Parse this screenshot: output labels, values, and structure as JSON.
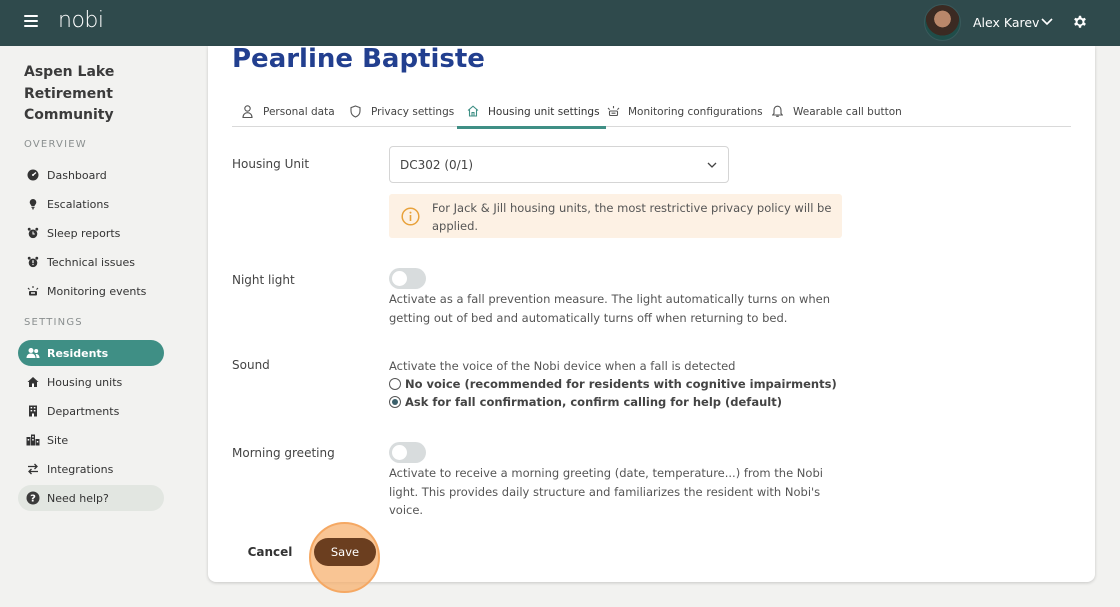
{
  "header": {
    "app_name": "nobi",
    "user_name": "Alex Karev"
  },
  "sidebar": {
    "org_name": "Aspen Lake Retirement Community",
    "overview_heading": "OVERVIEW",
    "settings_heading": "SETTINGS",
    "overview_items": [
      {
        "label": "Dashboard",
        "icon": "dashboard-icon"
      },
      {
        "label": "Escalations",
        "icon": "escalation-icon"
      },
      {
        "label": "Sleep reports",
        "icon": "alarm-clock-icon"
      },
      {
        "label": "Technical issues",
        "icon": "warning-clock-icon"
      },
      {
        "label": "Monitoring events",
        "icon": "monitoring-icon"
      }
    ],
    "settings_items": [
      {
        "label": "Residents",
        "icon": "users-icon",
        "active": true
      },
      {
        "label": "Housing units",
        "icon": "house-icon"
      },
      {
        "label": "Departments",
        "icon": "building-icon"
      },
      {
        "label": "Site",
        "icon": "city-icon"
      },
      {
        "label": "Integrations",
        "icon": "arrows-icon"
      }
    ],
    "help_label": "Need help?"
  },
  "main": {
    "title": "Pearline Baptiste",
    "tabs": [
      {
        "label": "Personal data",
        "icon": "person-icon"
      },
      {
        "label": "Privacy settings",
        "icon": "shield-icon"
      },
      {
        "label": "Housing unit settings",
        "icon": "house-icon",
        "active": true
      },
      {
        "label": "Monitoring configurations",
        "icon": "monitoring-icon"
      },
      {
        "label": "Wearable call button",
        "icon": "bell-icon"
      }
    ],
    "housing_unit": {
      "label": "Housing Unit",
      "value": "DC302 (0/1)",
      "notice": "For Jack & Jill housing units, the most restrictive privacy policy will be applied."
    },
    "night_light": {
      "label": "Night light",
      "enabled": false,
      "description": "Activate as a fall prevention measure. The light automatically turns on when getting out of bed and automatically turns off when returning to bed."
    },
    "sound": {
      "label": "Sound",
      "description": "Activate the voice of the Nobi device when a fall is detected",
      "options": [
        {
          "label": "No voice (recommended for residents with cognitive impairments)",
          "selected": false
        },
        {
          "label": "Ask for fall confirmation, confirm calling for help (default)",
          "selected": true
        }
      ]
    },
    "morning_greeting": {
      "label": "Morning greeting",
      "enabled": false,
      "description": "Activate to receive a morning greeting (date, temperature...) from the Nobi light. This provides daily structure and familiarizes the resident with Nobi's voice."
    },
    "actions": {
      "cancel_label": "Cancel",
      "save_label": "Save"
    }
  },
  "colors": {
    "topbar": "#2f4a4c",
    "accent": "#3f8f85",
    "title": "#223f8f",
    "save_button": "#6b3e1f",
    "notice_bg": "#fdf1e4",
    "notice_icon": "#e8a23c"
  }
}
